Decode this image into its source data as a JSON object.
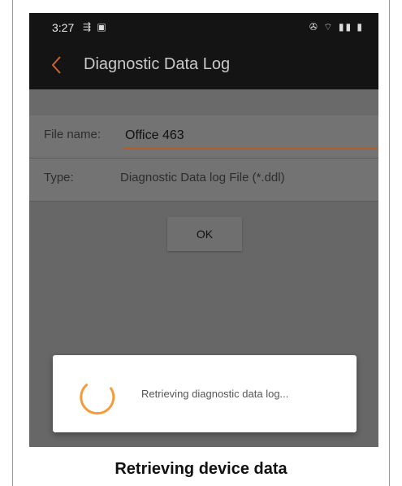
{
  "status_bar": {
    "time": "3:27",
    "notification_icons": "⇶ ▣",
    "system_icons": "✇ ⌔ ▮▮ ▮"
  },
  "app_bar": {
    "title": "Diagnostic Data Log",
    "back_icon": "chevron-left-icon",
    "accent_color": "#c8642e"
  },
  "form": {
    "file_name_label": "File name:",
    "file_name_value": "Office 463",
    "type_label": "Type:",
    "type_value": "Diagnostic Data log File (*.ddl)"
  },
  "ok_label": "OK",
  "progress_dialog": {
    "message": "Retrieving diagnostic data log...",
    "spinner_color": "#f59b3a"
  },
  "caption": "Retrieving device data"
}
